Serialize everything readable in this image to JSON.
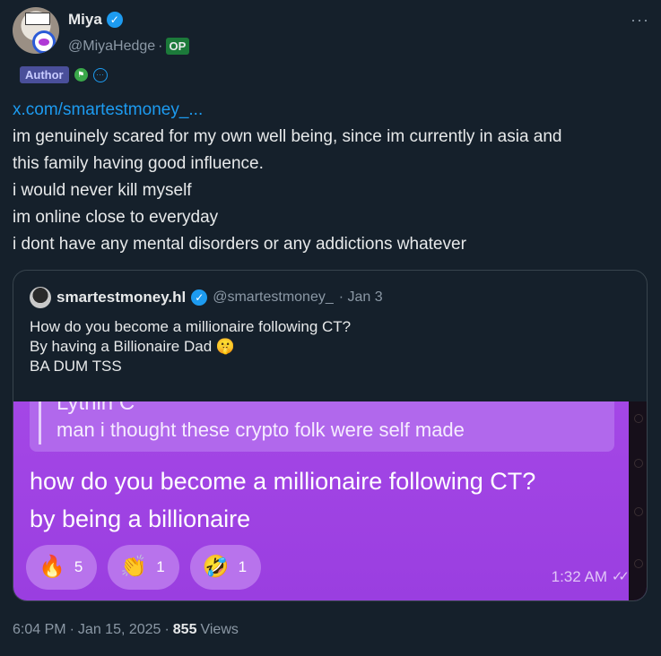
{
  "author": {
    "display_name": "Miya",
    "handle": "@MiyaHedge",
    "handle_separator": "·",
    "op_badge": "OP",
    "author_badge": "Author",
    "more_label": "···"
  },
  "tweet": {
    "link": "x.com/smartestmoney_...",
    "lines": [
      "im genuinely scared for my own well being, since im currently in asia and",
      "this family having good influence.",
      "i would never kill myself",
      "im online close to everyday",
      "i dont have any mental disorders or any addictions whatever"
    ]
  },
  "quote": {
    "name": "smartestmoney.hl",
    "handle": "@smartestmoney_",
    "date": "· Jan 3",
    "lines": [
      "How do you become a millionaire following CT?",
      "By having a Billionaire Dad 🤫",
      "BA DUM TSS"
    ],
    "image": {
      "reply_name": "Lythin C",
      "reply_text": "man i thought these crypto folk were self made",
      "message_lines": [
        "how do you become a millionaire following CT?",
        "by being a billionaire"
      ],
      "reactions": [
        {
          "emoji": "🔥",
          "count": "5"
        },
        {
          "emoji": "👏",
          "count": "1"
        },
        {
          "emoji": "🤣",
          "count": "1"
        }
      ],
      "time": "1:32 AM"
    }
  },
  "footer": {
    "time": "6:04 PM",
    "sep1": "·",
    "date": "Jan 15, 2025",
    "sep2": "·",
    "views_count": "855",
    "views_label": "Views"
  },
  "colors": {
    "background": "#15202b",
    "link": "#1d9bf0",
    "verified": "#1d9bf0",
    "op_badge": "#1c7a3a",
    "author_badge": "#4a4f9a",
    "telegram_purple": "#a447e6"
  }
}
